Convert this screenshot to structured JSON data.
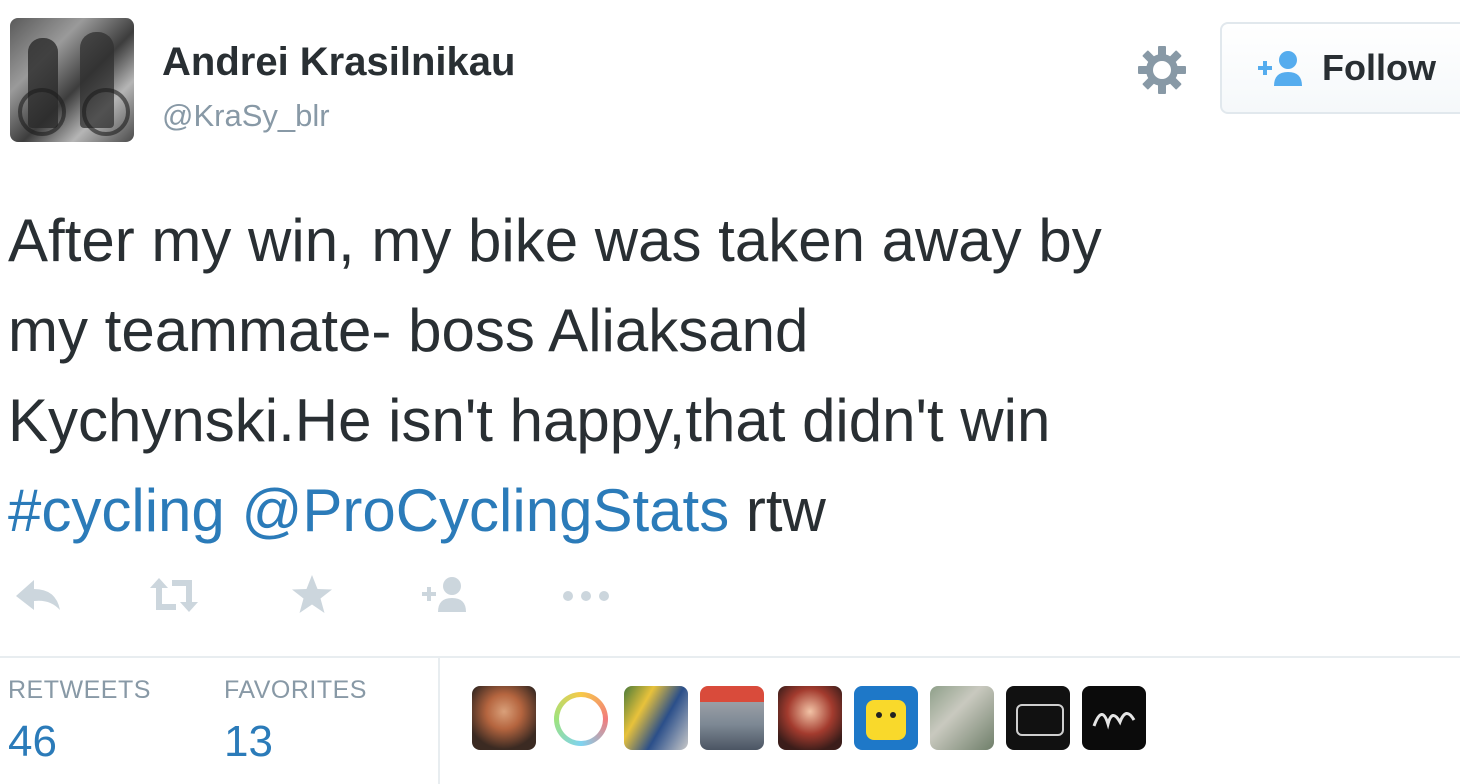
{
  "user": {
    "name": "Andrei Krasilnikau",
    "handle": "@KraSy_blr"
  },
  "follow_button": {
    "label": "Follow"
  },
  "tweet": {
    "line1": "After my win, my bike was taken away by",
    "line2": "my teammate- boss Aliaksand",
    "line3": "Kychynski.He isn't happy,that didn't win",
    "hashtag": "#cycling",
    "mention": "@ProCyclingStats",
    "tail": "rtw"
  },
  "actions": [
    "reply-icon",
    "retweet-icon",
    "favorite-icon",
    "follow-user-icon",
    "more-icon"
  ],
  "stats": {
    "retweets_label": "RETWEETS",
    "retweets_count": "46",
    "favorites_label": "FAVORITES",
    "favorites_count": "13"
  },
  "colors": {
    "link": "#2b7bb9",
    "text": "#292f33",
    "muted": "#8899a6",
    "icon": "#ccd6dd"
  }
}
